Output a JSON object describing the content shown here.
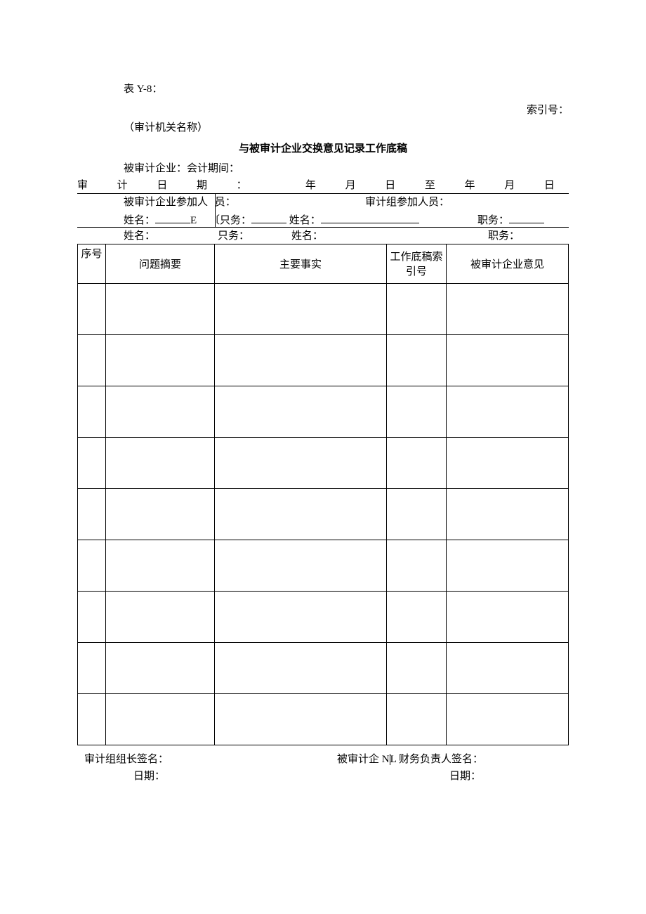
{
  "header": {
    "form_code": "表 Y-8：",
    "index_label": "索引号：",
    "org_name": "（审计机关名称）",
    "title": "与被审计企业交换意见记录工作底稿"
  },
  "meta": {
    "line1a": "被审计企业：",
    "line1b": "会计期间：",
    "audit_date_label_chars": [
      "审",
      "计",
      "日",
      "期",
      "：",
      "",
      "年",
      "月",
      "日",
      "至",
      "年",
      "月",
      "日"
    ],
    "participants_left": "被审计企业参加人",
    "participants_left_suffix": "员：",
    "participants_right": "审计组参加人员：",
    "name_label": "姓名：",
    "duty_label_open": "〔只务：",
    "duty_label": "只务：",
    "duty_label_cn": "职务：",
    "stray_e": "E"
  },
  "table": {
    "headers": {
      "seq": "序号",
      "c1": "问题摘要",
      "c2": "主要事实",
      "c3": "工作底稿索引号",
      "c4": "被审计企业意见"
    },
    "row_count": 9
  },
  "footer": {
    "sig_left": "审计组组长签名：",
    "sig_right_a": "被审计企 N",
    "sig_right_b": "L 财务负责人签名：",
    "date_label": "日期："
  }
}
